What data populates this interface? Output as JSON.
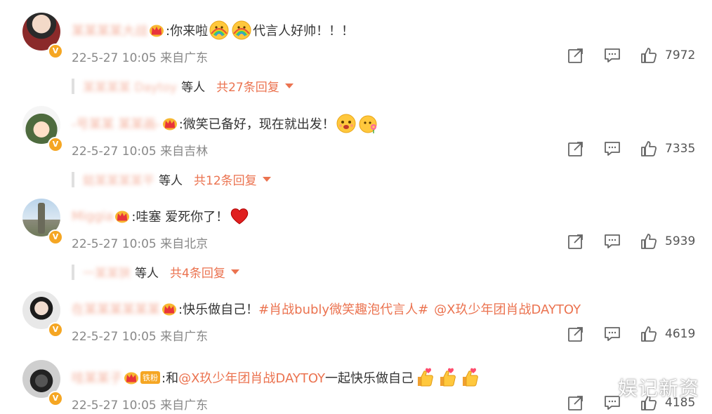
{
  "comments": [
    {
      "username": "某某某某大战",
      "text": ":你来啦",
      "text_after": "代言人好帅！！！",
      "time": "22-5-27 10:05",
      "location": "来自广东",
      "likes": "7972",
      "reply_names": "某某某某 Daytoy",
      "reply_deng": "等人",
      "reply_more": "共27条回复",
      "avatar_color": "#8b2a2a"
    },
    {
      "username": "-号某某 某某画-",
      "text": ":微笑已备好，现在就出发！",
      "time": "22-5-27 10:05",
      "location": "来自吉林",
      "likes": "7335",
      "reply_names": "鋕某某某某平",
      "reply_deng": "等人",
      "reply_more": "共12条回复",
      "avatar_color": "#5a7a4a"
    },
    {
      "username": "Miggia",
      "text": ":哇塞 爱死你了！",
      "time": "22-5-27 10:05",
      "location": "来自北京",
      "likes": "5939",
      "reply_names": "一某某狭",
      "reply_deng": "等人",
      "reply_more": "共4条回复",
      "avatar_color": "#7a9cb8"
    },
    {
      "username": "在某某某某某某",
      "text": ":快乐做自己！",
      "hashtag": "#肖战bubly微笑趣泡代言人#",
      "mention": "@X玖少年团肖战DAYTOY",
      "time": "22-5-27 10:05",
      "location": "来自广东",
      "likes": "4619",
      "avatar_color": "#222222"
    },
    {
      "username": "哇某某子",
      "fan_badge": "铁粉",
      "text": ":和",
      "mention": "@X玖少年团肖战DAYTOY",
      "text_after": " 一起快乐做自己",
      "time": "22-5-27 10:05",
      "location": "来自广东",
      "likes": "4185",
      "avatar_color": "#333333"
    }
  ],
  "watermark": "娱记新资",
  "icons": {
    "share": "share-icon",
    "comment": "comment-icon",
    "like": "thumbs-up-icon",
    "crown": "crown-icon",
    "verified": "verified-icon"
  },
  "colors": {
    "accent": "#eb7350",
    "verified": "#f5a623"
  }
}
